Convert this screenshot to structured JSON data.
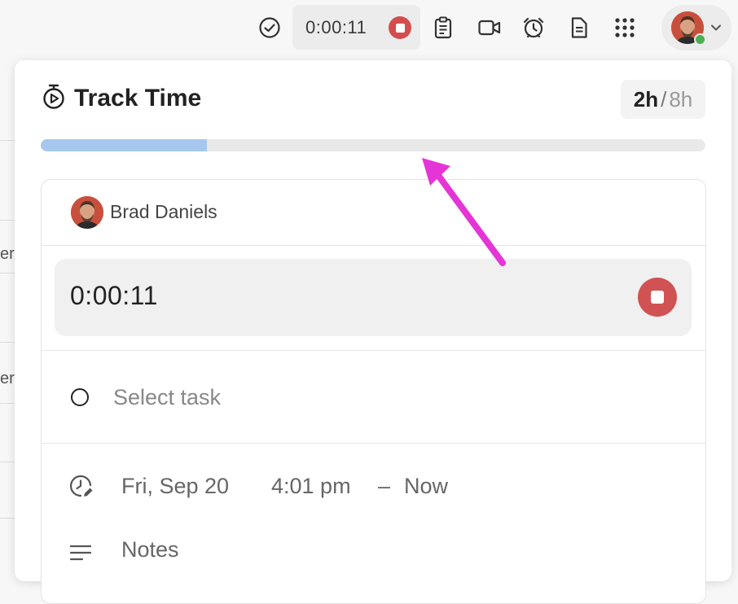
{
  "topbar": {
    "timer_value": "0:00:11",
    "icons": [
      "check-circle-icon",
      "clipboard-icon",
      "video-icon",
      "alarm-icon",
      "document-icon",
      "apps-grid-icon",
      "chevron-down-icon"
    ]
  },
  "background": {
    "fragment_1": "er",
    "fragment_2": "er"
  },
  "panel": {
    "title": "Track Time",
    "hours_done": "2h",
    "hours_sep": "/",
    "hours_goal": "8h",
    "progress_fraction": 0.25
  },
  "card": {
    "user_name": "Brad Daniels",
    "running_time": "0:00:11",
    "task_placeholder": "Select task",
    "date": "Fri, Sep 20",
    "start_time": "4:01 pm",
    "dash": "–",
    "end_time": "Now",
    "notes_label": "Notes"
  },
  "colors": {
    "stop_red": "#d44d4d",
    "progress_fill": "#a6c8ef",
    "annotation_arrow": "#e535d6",
    "presence_green": "#4caf50"
  }
}
